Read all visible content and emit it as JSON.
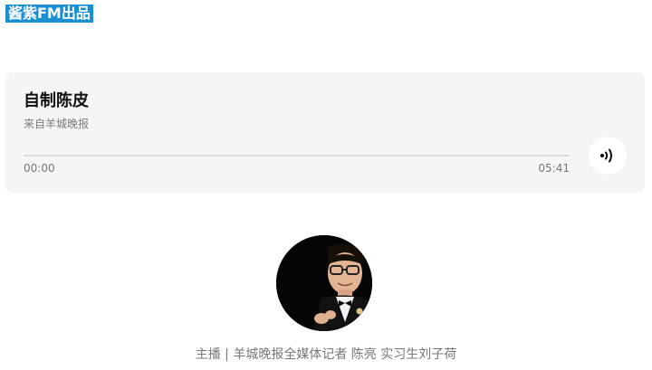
{
  "brand": {
    "label": "酱紫FM出品"
  },
  "audio": {
    "title": "自制陈皮",
    "source": "来自羊城晚报",
    "current_time": "00:00",
    "duration": "05:41",
    "progress": 0.0,
    "play_icon": "sound-wave-icon"
  },
  "presenter": {
    "avatar_icon": "presenter-photo",
    "credit": "主播 | 羊城晚报全媒体记者 陈亮 实习生刘子荷"
  },
  "colors": {
    "accent": "#1a8fd4",
    "card_background": "#f5f5f5",
    "muted_text": "#777777"
  }
}
